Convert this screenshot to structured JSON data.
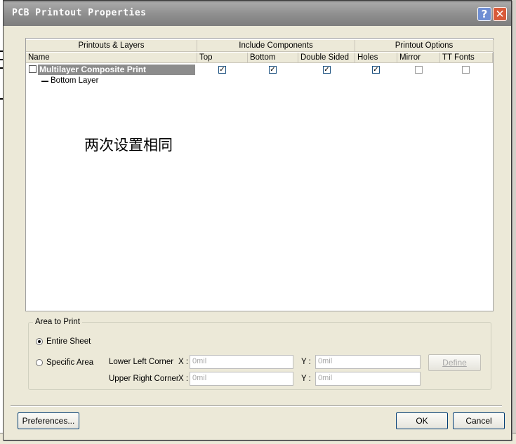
{
  "window": {
    "title": "PCB Printout Properties",
    "help_glyph": "?",
    "close_glyph": "✕"
  },
  "table": {
    "groups": [
      "Printouts & Layers",
      "Include Components",
      "Printout Options"
    ],
    "columns": [
      "Name",
      "Top",
      "Bottom",
      "Double Sided",
      "Holes",
      "Mirror",
      "TT Fonts"
    ],
    "rows": [
      {
        "name": "Multilayer Composite Print",
        "top": true,
        "bottom": true,
        "double_sided": true,
        "holes": true,
        "mirror": false,
        "tt_fonts": false
      }
    ],
    "sub_rows": [
      "Bottom Layer"
    ],
    "check_glyph": "✓"
  },
  "annotation": "两次设置相同",
  "area_to_print": {
    "legend": "Area to Print",
    "entire_sheet": "Entire Sheet",
    "specific_area": "Specific Area",
    "selected": "entire_sheet",
    "lower_left_label": "Lower Left Corner",
    "upper_right_label": "Upper Right Corner",
    "x_label": "X :",
    "y_label": "Y :",
    "lower_left_x": "0mil",
    "lower_left_y": "0mil",
    "upper_right_x": "0mil",
    "upper_right_y": "0mil",
    "define_label": "Define"
  },
  "buttons": {
    "preferences": "Preferences...",
    "ok": "OK",
    "cancel": "Cancel"
  }
}
